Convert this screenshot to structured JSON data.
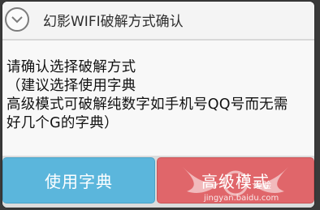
{
  "dialog": {
    "title": "幻影WIFI破解方式确认",
    "header_icon": "chevron-down-circle-icon",
    "message_lines": [
      "请确认选择破解方式",
      "（建议选择使用字典",
      "高级模式可破解纯数字如手机号QQ号而无需",
      "好几个G的字典）"
    ]
  },
  "buttons": {
    "use_dictionary": "使用字典",
    "advanced_mode": "高级模式"
  },
  "watermark": {
    "brand": "经验",
    "url": "jingyan.baidu.com"
  },
  "colors": {
    "dictionary_button": "#5bb6dc",
    "advanced_button": "#e0666a"
  }
}
